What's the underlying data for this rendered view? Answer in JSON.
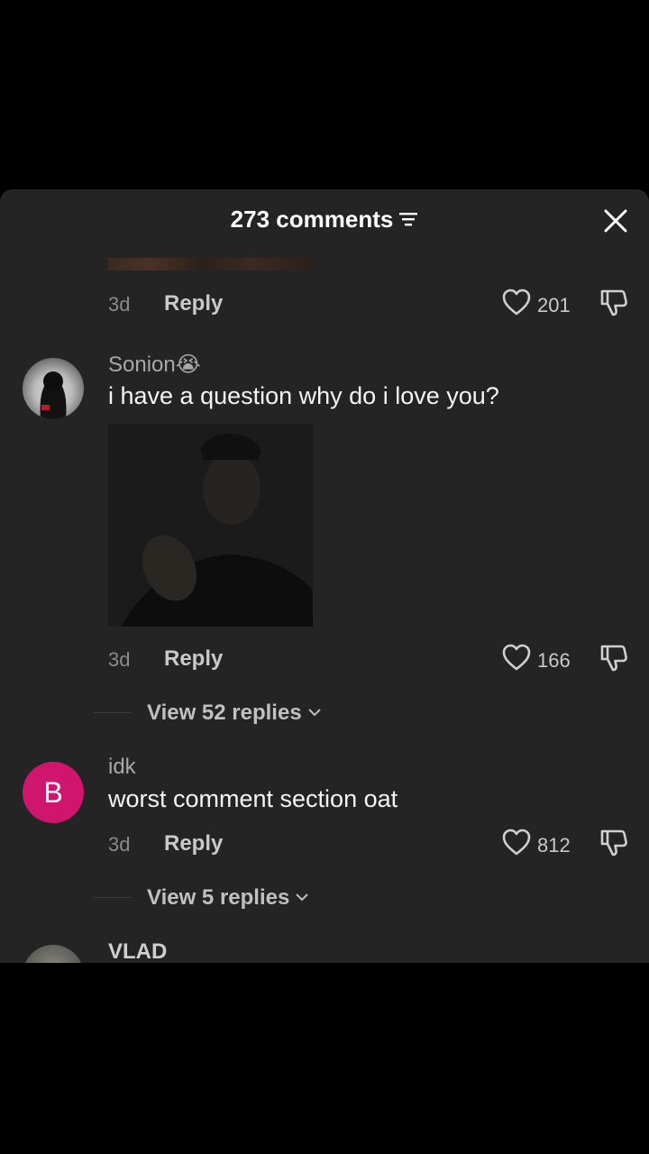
{
  "header": {
    "title": "273 comments"
  },
  "comments": [
    {
      "time": "3d",
      "reply_label": "Reply",
      "likes": "201"
    },
    {
      "username": "Sonion😭",
      "text": "i have a question why do i love you?",
      "time": "3d",
      "reply_label": "Reply",
      "likes": "166",
      "view_replies": "View 52 replies"
    },
    {
      "avatar_letter": "B",
      "username": "idk",
      "text": "worst comment section oat",
      "time": "3d",
      "reply_label": "Reply",
      "likes": "812",
      "view_replies": "View 5 replies"
    },
    {
      "username": "VLAD"
    }
  ],
  "colors": {
    "sheet_bg": "#242424",
    "avatar_b": "#d0156e",
    "page_bg": "#000000"
  }
}
